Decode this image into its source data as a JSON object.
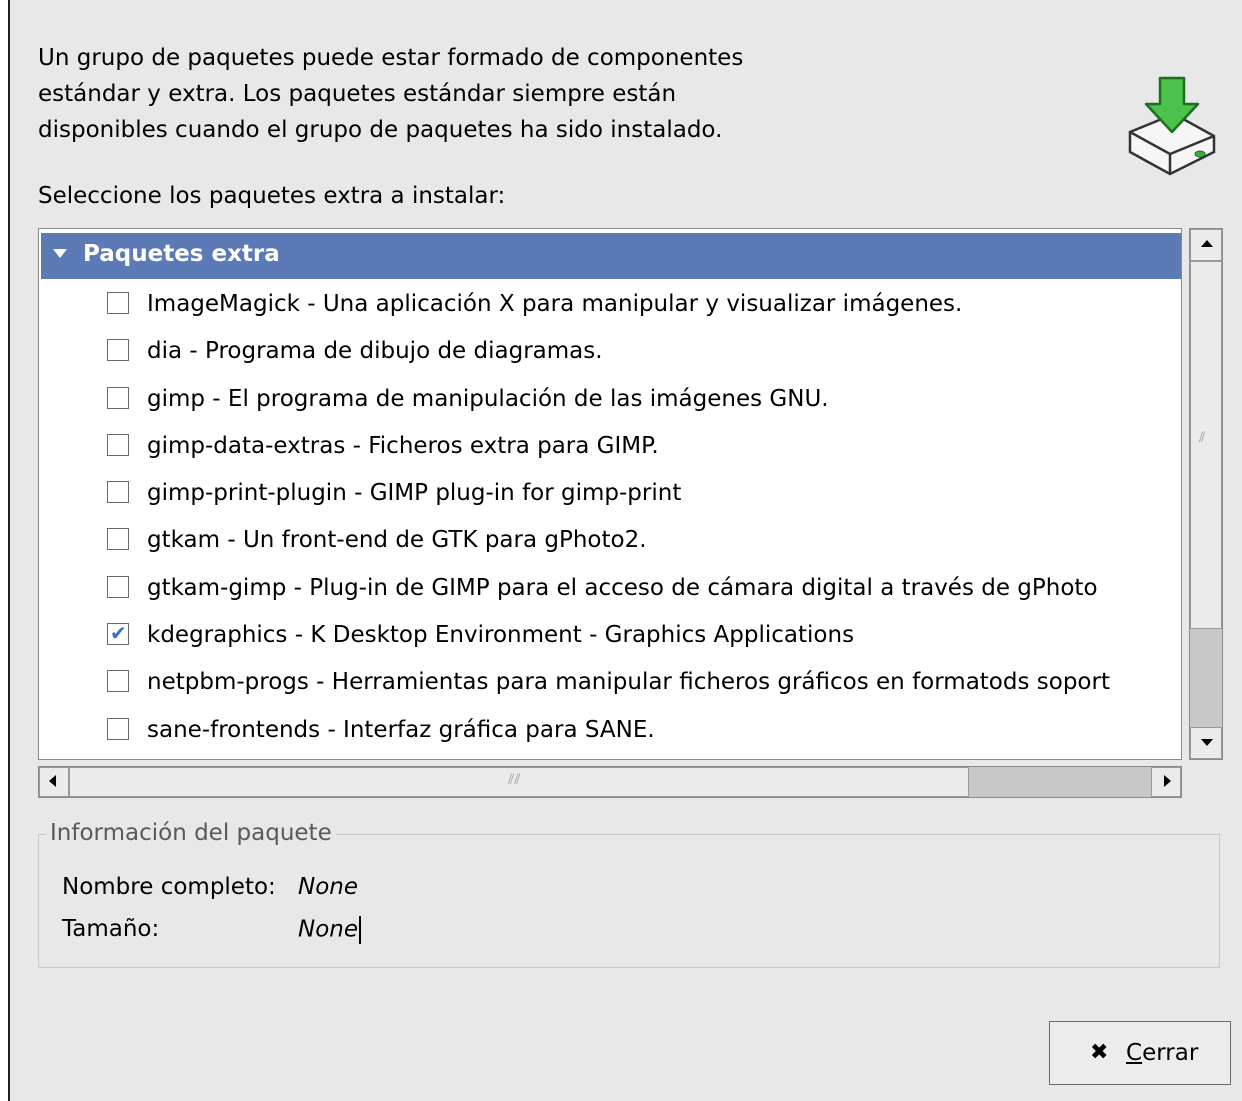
{
  "intro": {
    "lines": [
      "Un grupo de paquetes puede estar formado de componentes",
      "estándar y extra. Los paquetes estándar siempre están",
      "disponibles cuando el grupo de paquetes ha sido instalado."
    ]
  },
  "subtitle": "Seleccione los paquetes extra a instalar:",
  "header_icon": "package-install-icon",
  "package_list": {
    "group_label": "Paquetes extra",
    "group_expanded": true,
    "items": [
      {
        "label": "ImageMagick - Una aplicación X para manipular y visualizar imágenes.",
        "checked": false
      },
      {
        "label": "dia - Programa de dibujo de diagramas.",
        "checked": false
      },
      {
        "label": "gimp - El programa de manipulación de las imágenes GNU.",
        "checked": false
      },
      {
        "label": "gimp-data-extras - Ficheros extra para GIMP.",
        "checked": false
      },
      {
        "label": "gimp-print-plugin - GIMP plug-in for gimp-print",
        "checked": false
      },
      {
        "label": "gtkam - Un front-end de GTK para gPhoto2.",
        "checked": false
      },
      {
        "label": "gtkam-gimp - Plug-in de GIMP para el acceso de cámara digital a través de gPhoto",
        "checked": false
      },
      {
        "label": "kdegraphics - K Desktop Environment - Graphics Applications",
        "checked": true
      },
      {
        "label": "netpbm-progs - Herramientas para manipular ficheros gráficos en formatods  soport",
        "checked": false
      },
      {
        "label": "sane-frontends - Interfaz gráfica para SANE.",
        "checked": false
      }
    ]
  },
  "package_info": {
    "legend": "Información del paquete",
    "full_name_label": "Nombre completo:",
    "full_name_value": "None",
    "size_label": "Tamaño:",
    "size_value": "None"
  },
  "close_button": {
    "mnemonic": "C",
    "label_rest": "errar"
  },
  "colors": {
    "selection": "#5c7ab6",
    "dialog_bg": "#e8e8e8",
    "check_mark": "#3a6fc9",
    "icon_arrow": "#3cae3c"
  }
}
